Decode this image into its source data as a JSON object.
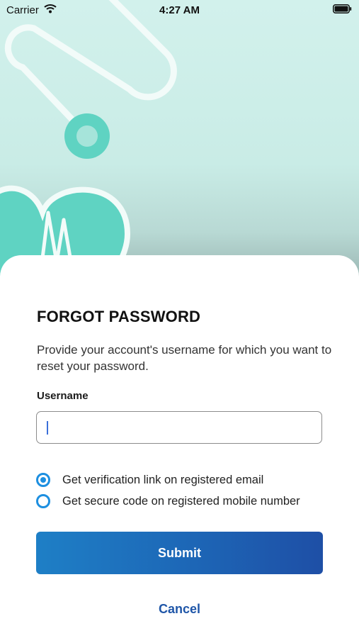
{
  "status_bar": {
    "carrier": "Carrier",
    "time": "4:27 AM",
    "wifi_icon": "wifi-icon",
    "battery_icon": "battery-icon"
  },
  "header_illustration": {
    "icon": "stethoscope-heart-illustration",
    "colors": {
      "background": "#cdeee8",
      "accent": "#5fd3c2",
      "outline": "#f2fbf9"
    }
  },
  "form": {
    "title": "FORGOT PASSWORD",
    "description": "Provide your account's username  for which you want to reset your password.",
    "username_label": "Username",
    "username_value": "",
    "username_placeholder": "",
    "options": [
      {
        "label": "Get verification link on registered email",
        "selected": true
      },
      {
        "label": "Get secure code on registered mobile number",
        "selected": false
      }
    ],
    "submit_label": "Submit",
    "cancel_label": "Cancel"
  },
  "colors": {
    "primary_blue": "#1d66b6",
    "radio_blue": "#1d8fe0",
    "link_blue": "#1f56a8"
  }
}
